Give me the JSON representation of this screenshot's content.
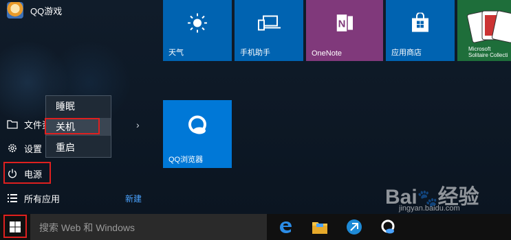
{
  "start_menu": {
    "most_used": [
      {
        "label": "QQ游戏",
        "icon": "qq-game-icon"
      }
    ],
    "file_explorer_label": "文件资",
    "settings_label": "设置",
    "power_label": "电源",
    "all_apps_label": "所有应用",
    "new_badge": "新建"
  },
  "power_menu": {
    "items": [
      {
        "label": "睡眠",
        "icon": "sleep"
      },
      {
        "label": "关机",
        "icon": "shutdown",
        "highlighted": true
      },
      {
        "label": "重启",
        "icon": "restart"
      }
    ]
  },
  "tiles": {
    "weather": {
      "label": "天气",
      "color": "#0063b1",
      "icon": "sun-icon"
    },
    "phone_companion": {
      "label": "手机助手",
      "color": "#0063b1",
      "icon": "phone-laptop-icon"
    },
    "onenote": {
      "label": "OneNote",
      "color": "#80397b",
      "icon": "onenote-icon"
    },
    "store": {
      "label": "应用商店",
      "color": "#0063b1",
      "icon": "store-bag-icon"
    },
    "solitaire": {
      "label": "Microsoft\nSolitaire Collecti",
      "color": "#1e6e3a",
      "icon": "playing-cards-icon"
    },
    "qq_browser": {
      "label": "QQ浏览器",
      "color": "#0078d7",
      "icon": "qq-browser-icon"
    }
  },
  "taskbar": {
    "search_placeholder": "搜索 Web 和 Windows",
    "pinned": [
      "edge-icon",
      "file-explorer-icon",
      "maxthon-icon",
      "qq-browser-icon"
    ]
  },
  "watermark": {
    "brand": "Baidu 经验",
    "url": "jingyan.baidu.com"
  },
  "colors": {
    "accent": "#0078d7",
    "highlight_box": "#e0201f",
    "link": "#4aa3ff"
  }
}
